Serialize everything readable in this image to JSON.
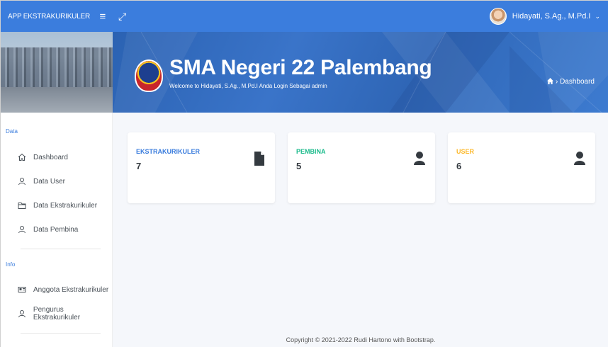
{
  "topbar": {
    "brand": "APP EKSTRAKURIKULER",
    "hamburger_icon": "≡",
    "fullscreen_icon": "⤢",
    "user_name": "Hidayati, S.Ag., M.Pd.I",
    "chevron": "⌄"
  },
  "banner": {
    "school_name": "SMA Negeri 22 Palembang",
    "welcome": "Welcome to Hidayati, S.Ag., M.Pd.I Anda Login Sebagai admin",
    "breadcrumb": "› Dashboard",
    "breadcrumb_icon": "home-icon"
  },
  "sidebar": {
    "sections": [
      {
        "title": "Data",
        "items": [
          {
            "label": "Dashboard",
            "icon": "home-icon"
          },
          {
            "label": "Data User",
            "icon": "user-icon"
          },
          {
            "label": "Data Ekstrakurikuler",
            "icon": "folder-icon"
          },
          {
            "label": "Data Pembina",
            "icon": "user-icon"
          }
        ]
      },
      {
        "title": "Info",
        "items": [
          {
            "label": "Anggota Ekstrakurikuler",
            "icon": "id-card-icon"
          },
          {
            "label": "Pengurus Ekstrakurikuler",
            "icon": "user-icon"
          }
        ]
      }
    ]
  },
  "cards": [
    {
      "title": "EKSTRAKURIKULER",
      "value": "7",
      "icon": "file-icon",
      "color": "#3b7ddd"
    },
    {
      "title": "PEMBINA",
      "value": "5",
      "icon": "user-icon",
      "color": "#1cbb8c"
    },
    {
      "title": "USER",
      "value": "6",
      "icon": "user-icon",
      "color": "#fcb92c"
    }
  ],
  "footer": "Copyright © 2021-2022 Rudi Hartono with Bootstrap."
}
